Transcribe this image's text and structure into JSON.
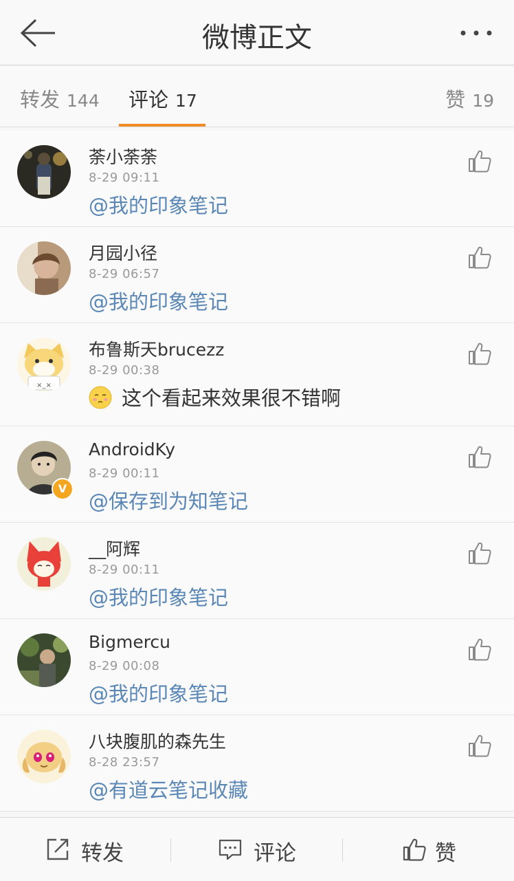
{
  "header": {
    "title": "微博正文",
    "back_icon": "back-arrow-icon",
    "more_icon": "more-dots-icon"
  },
  "tabs": {
    "repost": {
      "label": "转发",
      "count": "144"
    },
    "comment": {
      "label": "评论",
      "count": "17",
      "active": true
    },
    "like": {
      "label": "赞",
      "count": "19"
    },
    "accent_color": "#f08a24"
  },
  "comments": [
    {
      "name": "荼小荼荼",
      "time": "8-29 09:11",
      "prefix": "",
      "text": "@我的印象笔记",
      "verified": false
    },
    {
      "name": "月园小径",
      "time": "8-29 06:57",
      "prefix": "",
      "text": "@我的印象笔记",
      "verified": false
    },
    {
      "name": "布鲁斯天brucezz",
      "time": "8-29 00:38",
      "prefix": "",
      "text": "这个看起来效果很不错啊",
      "emoji": "shy-face-emoji",
      "verified": false
    },
    {
      "name": "AndroidKy",
      "time": "8-29 00:11",
      "prefix": "",
      "text": "@保存到为知笔记",
      "verified": true,
      "badge": "V"
    },
    {
      "name": "__阿辉",
      "time": "8-29 00:11",
      "prefix": "",
      "text": "@我的印象笔记",
      "verified": false
    },
    {
      "name": "Bigmercu",
      "time": "8-29 00:08",
      "prefix": "",
      "text": "@我的印象笔记",
      "verified": false
    },
    {
      "name": "八块腹肌的森先生",
      "time": "8-28 23:57",
      "prefix": "",
      "text": "@有道云笔记收藏",
      "verified": false
    }
  ],
  "bottom_bar": {
    "repost": {
      "label": "转发",
      "icon": "share-out-icon"
    },
    "comment": {
      "label": "评论",
      "icon": "comment-bubble-icon"
    },
    "like": {
      "label": "赞",
      "icon": "thumbs-up-icon"
    }
  },
  "colors": {
    "mention": "#5a87b5",
    "verified_badge": "#f4a620"
  }
}
